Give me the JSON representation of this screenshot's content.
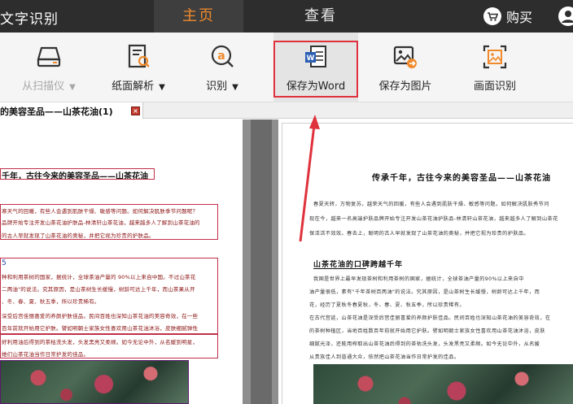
{
  "header": {
    "app_title": "文字识别",
    "tabs": [
      {
        "label": "主页",
        "active": true
      },
      {
        "label": "查看",
        "active": false
      }
    ],
    "buy_label": "购买"
  },
  "toolbar": {
    "items": [
      {
        "label": "从扫描仪",
        "icon": "scanner-icon",
        "disabled": true,
        "dropdown": true
      },
      {
        "label": "纸面解析",
        "icon": "document-search-icon",
        "disabled": false,
        "dropdown": true
      },
      {
        "label": "识别",
        "icon": "ocr-a-icon",
        "disabled": false,
        "dropdown": true
      },
      {
        "label": "保存为Word",
        "icon": "word-icon",
        "disabled": false,
        "dropdown": false,
        "highlighted": true
      },
      {
        "label": "保存为图片",
        "icon": "image-export-icon",
        "disabled": false,
        "dropdown": false
      },
      {
        "label": "画面识别",
        "icon": "screen-capture-icon",
        "disabled": false,
        "dropdown": false
      }
    ],
    "caret": "▼"
  },
  "doc_tab": {
    "label": "的美容圣品——山茶花油(1)",
    "close": "×"
  },
  "left_doc": {
    "title": "千年，古往今来的美容圣品——山茶花油",
    "p1": [
      "寒天气的回暖，有些人会遇到肌肤干燥、敏感等问题。如何解决肌肤季节问题呢？",
      "品牌开始专注开发山茶花油护肤品-林清轩山茶花油，越来越多人了解到山茶花油的",
      "的古人早就发现了山茶花油的奥秘，并把它视为珍贵的护肤品。"
    ],
    "marker": "5",
    "p2": [
      "种和利用茶树的国家，据统计，全球茶油产量的 90%以上来自中国。不过山茶花",
      "二两油\"的说法。究其原因，是山茶树生长缓慢，树龄可达上千年，而山茶果从开",
      "、冬、春、夏、秋五季，所以珍贵稀有。",
      "深受后宫佳丽喜爱的养颜护肤佳品。民间百姓也深知山茶花油的美容奇效，在一些",
      "百年前就开始用它护肤。譬如明朝士家族女性喜欢用山茶花油沐浴，皮肤细腻弹性",
      "好利用油后得到的茶枯洗头发，头发黑亮又柔顺。如今无论中外，从名媛到明星，",
      "她们山茶花油当作日常护发的佳品。"
    ]
  },
  "right_doc": {
    "title": "传承千年，古往今来的美容圣品——山茶花油",
    "p1": [
      "春夏天转，万物复苏，越荣天气的回暖，有些人会遇到肌肤干燥、敏感等问题。如何解决肌肤秀节问",
      "现在今，越来一名高端护肤品牌开始专注开发山茶花油护肤品-林清轩山茶花油，越来越多人了解到山茶花",
      "保活活不效效。春去上，聪明的古人早就发现了山茶花油的奥秘，并把它视为珍贵的护肤品。"
    ],
    "subtitle": "山茶花油的口碑跨越千年",
    "p2": [
      "我国是世界上最早发现茶树和利用茶树的国家，据统计，全球茶油产量的90%以上来自中",
      "油产量很低，素有\"千年茶树百两油\"的说法。究其原因，是山茶树生长缓慢，树龄可达上千年，而",
      "花，经历了夏秋冬春夏秋，冬、春、夏、秋五季，所以珍贵稀有。",
      "在古代宫廷，山茶花油是深受后宫佳丽喜爱的养颜护肤佳品。民间百姓也深知山茶花油的美容奇效，在",
      "的茶树种植区，当地百姓数百年前就开始用它护肤。譬如明朝士家族女性喜欢用山茶花油沐浴，皮肤",
      "细腻光泽，还能用榨取出山茶花油后得到的茶枯洗头发，头发黑亮又柔顺。如今无论中外，从名媛",
      "从贵族佳人到普通大众，依然把山茶花油当作日常护发的佳品。"
    ]
  },
  "colors": {
    "topbar": "#2d2d2d",
    "active_tab": "#f08a2c",
    "highlight_border": "#e0323c",
    "arrow": "#e0323c"
  }
}
